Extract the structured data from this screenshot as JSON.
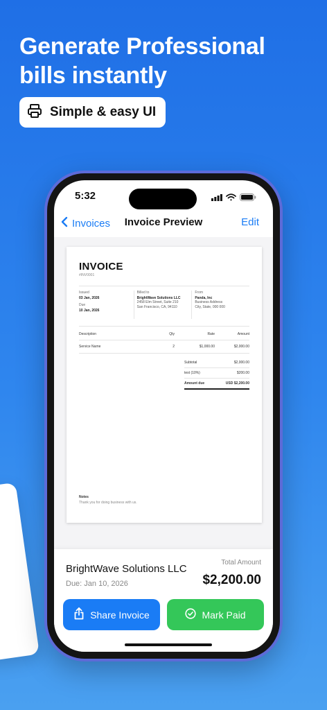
{
  "promo": {
    "headline": "Generate Professional bills instantly",
    "pill_label": "Simple & easy UI"
  },
  "status_bar": {
    "time": "5:32"
  },
  "nav": {
    "back_label": "Invoices",
    "title": "Invoice Preview",
    "edit_label": "Edit"
  },
  "invoice": {
    "title": "INVOICE",
    "number": "#INV0001",
    "issued_label": "Issued",
    "issued_date": "03 Jan, 2026",
    "due_label": "Due",
    "due_date": "10 Jan, 2026",
    "billed_to_label": "Billed to",
    "billed_to_name": "BrightWave Solutions LLC",
    "billed_to_addr1": "2458 Elm Street, Suite 210",
    "billed_to_addr2": "San Francisco, CA, 94110",
    "from_label": "From",
    "from_name": "Panda, Inc",
    "from_addr1": "Business Address",
    "from_addr2": "City, State, 000 000",
    "columns": {
      "description": "Description",
      "qty": "Qty",
      "rate": "Rate",
      "amount": "Amount"
    },
    "items": [
      {
        "description": "Service Name",
        "qty": "2",
        "rate": "$1,000.00",
        "amount": "$2,000.00"
      }
    ],
    "subtotal_label": "Subtotal",
    "subtotal_value": "$2,000.00",
    "tax_label": "test (10%)",
    "tax_value": "$200.00",
    "amount_due_label": "Amount due",
    "amount_due_value": "USD $2,200.00",
    "notes_label": "Notes",
    "notes_text": "Thank you for doing business with us."
  },
  "summary": {
    "client_name": "BrightWave Solutions LLC",
    "due_text": "Due: Jan 10, 2026",
    "total_label": "Total Amount",
    "total_value": "$2,200.00"
  },
  "actions": {
    "share_label": "Share Invoice",
    "paid_label": "Mark Paid"
  },
  "colors": {
    "accent_blue": "#1a7cf5",
    "success_green": "#34c759",
    "background_top": "#1f6fe6",
    "background_bottom": "#4aa0f0",
    "phone_frame": "#5d6bd8"
  },
  "icons": {
    "pill": "printer-icon",
    "back": "chevron-left-icon",
    "share": "share-icon",
    "paid": "check-circle-icon"
  }
}
